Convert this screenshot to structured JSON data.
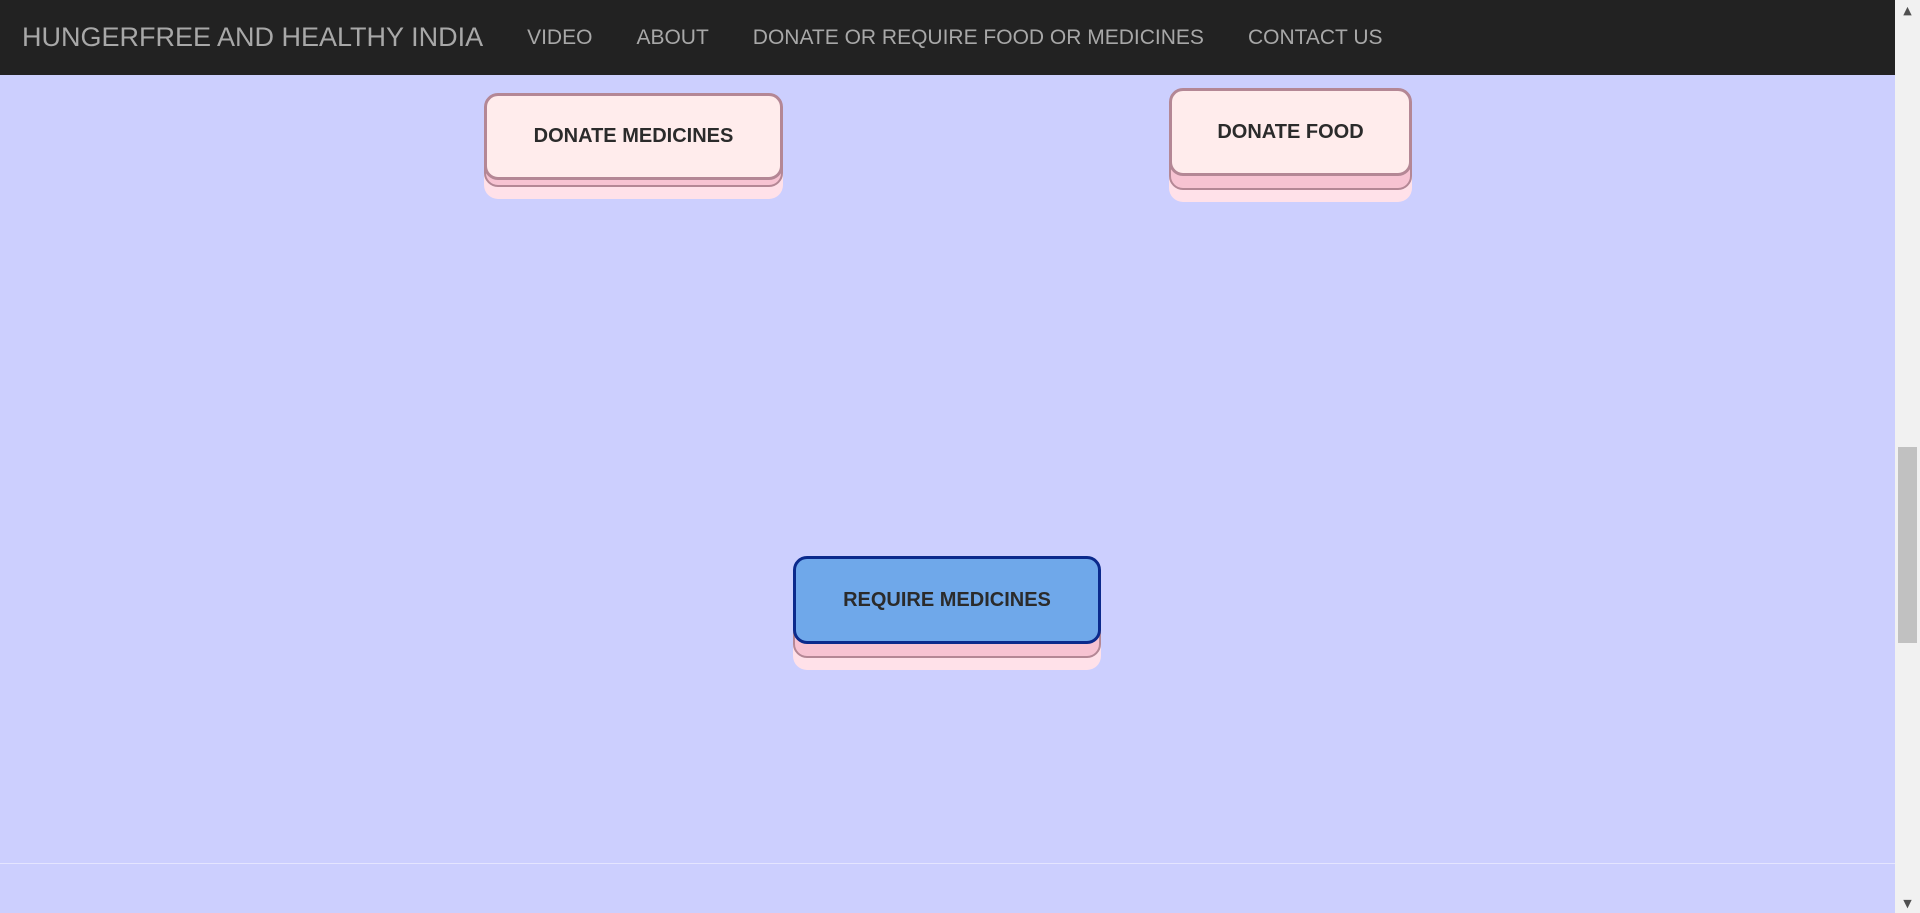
{
  "navbar": {
    "brand": "HUNGERFREE AND HEALTHY INDIA",
    "items": [
      {
        "label": "VIDEO"
      },
      {
        "label": "ABOUT"
      },
      {
        "label": "DONATE OR REQUIRE FOOD OR MEDICINES"
      },
      {
        "label": "CONTACT US"
      }
    ]
  },
  "main": {
    "donate_medicines_label": "DONATE MEDICINES",
    "donate_food_label": "DONATE FOOD",
    "require_medicines_label": "REQUIRE MEDICINES"
  },
  "scrollbar": {
    "up_icon": "▲",
    "down_icon": "▼",
    "position": 0.55
  },
  "colors": {
    "navbar_bg": "#222222",
    "nav_text": "#a8a8a8",
    "page_bg": "#cccffe",
    "pink_button_bg": "#ffecec",
    "pink_button_border": "#b48795",
    "blue_button_bg": "#6fa8ea",
    "blue_button_border": "#0b2a8c"
  }
}
